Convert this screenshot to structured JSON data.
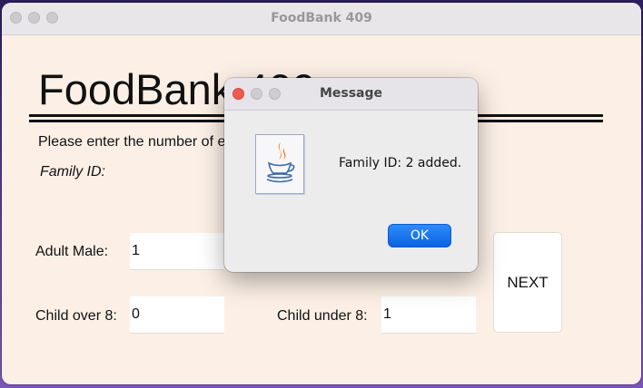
{
  "window": {
    "title": "FoodBank 409"
  },
  "app": {
    "heading": "FoodBank 409",
    "instruction": "Please enter the number of ea",
    "family_id_label": "Family ID:",
    "fields": {
      "adult_male": {
        "label": "Adult Male:",
        "value": "1"
      },
      "child_over_8": {
        "label": "Child over 8:",
        "value": "0"
      },
      "child_under_8": {
        "label": "Child under 8:",
        "value": "1"
      }
    },
    "next_label": "NEXT"
  },
  "dialog": {
    "title": "Message",
    "message": "Family ID: 2 added.",
    "ok_label": "OK",
    "icon": "java-coffee-cup-icon"
  },
  "colors": {
    "window_bg": "#fcf0e6",
    "accent_button": "#0a63e3",
    "close_red": "#ee5a52"
  }
}
